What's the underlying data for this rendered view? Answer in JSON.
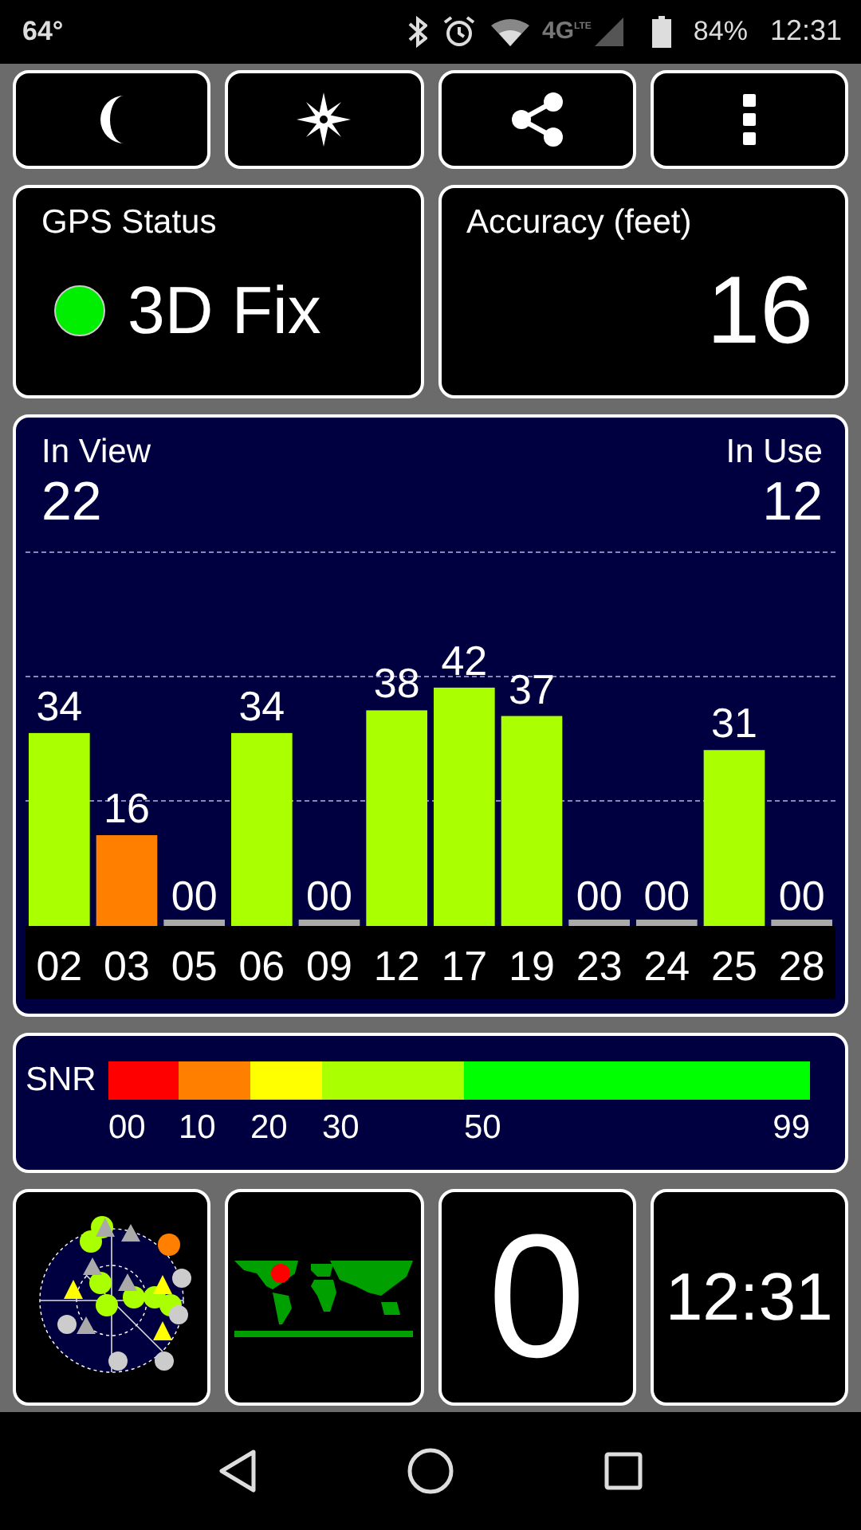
{
  "status_bar": {
    "temperature": "64°",
    "network": "4G",
    "network_sub": "LTE",
    "battery": "84%",
    "time": "12:31"
  },
  "toolbar": [
    {
      "kind": "night"
    },
    {
      "kind": "compass"
    },
    {
      "kind": "share"
    },
    {
      "kind": "menu"
    }
  ],
  "gps_status": {
    "title": "GPS Status",
    "locked": true,
    "value": "3D Fix"
  },
  "accuracy": {
    "title": "Accuracy (feet)",
    "value": "16"
  },
  "satellites": {
    "in_view_label": "In View",
    "in_view": "22",
    "in_use_label": "In Use",
    "in_use": "12",
    "chart_data": {
      "type": "bar",
      "categories": [
        "02",
        "03",
        "05",
        "06",
        "09",
        "12",
        "17",
        "19",
        "23",
        "24",
        "25",
        "28"
      ],
      "values": [
        34,
        16,
        0,
        34,
        0,
        38,
        42,
        37,
        0,
        0,
        31,
        0
      ],
      "value_labels": [
        "34",
        "16",
        "00",
        "34",
        "00",
        "38",
        "42",
        "37",
        "00",
        "00",
        "31",
        "00"
      ]
    }
  },
  "snr_legend": {
    "label": "SNR",
    "segments": [
      {
        "label": "00",
        "color": "#ff0000"
      },
      {
        "label": "10",
        "color": "#ff8000"
      },
      {
        "label": "20",
        "color": "#ffff00"
      },
      {
        "label": "30",
        "color": "#aaff00"
      },
      {
        "label": "50",
        "color": "#00ff00"
      }
    ],
    "end_label": "99"
  },
  "tiles": [
    {
      "kind": "skyplot"
    },
    {
      "kind": "worldmap"
    },
    {
      "kind": "text",
      "value": "0"
    },
    {
      "kind": "text",
      "value": "12:31"
    }
  ]
}
